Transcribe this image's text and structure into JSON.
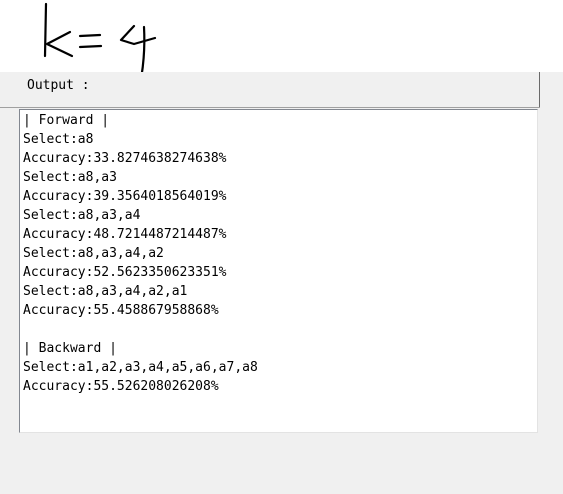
{
  "annotation": {
    "handwritten_text": "k = 4"
  },
  "output_panel": {
    "label": "Output :",
    "lines": [
      "| Forward |",
      "Select:a8",
      "Accuracy:33.8274638274638%",
      "Select:a8,a3",
      "Accuracy:39.3564018564019%",
      "Select:a8,a3,a4",
      "Accuracy:48.7214487214487%",
      "Select:a8,a3,a4,a2",
      "Accuracy:52.5623350623351%",
      "Select:a8,a3,a4,a2,a1",
      "Accuracy:55.458867958868%",
      "",
      "| Backward |",
      "Select:a1,a2,a3,a4,a5,a6,a7,a8",
      "Accuracy:55.526208026208%"
    ]
  }
}
